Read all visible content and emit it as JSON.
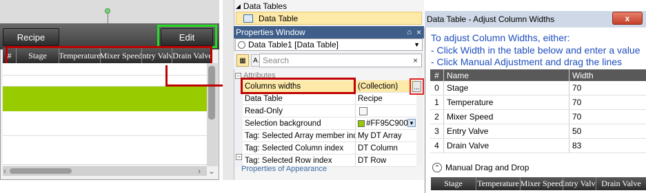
{
  "left_panel": {
    "recipe_button": "Recipe",
    "edit_button": "Edit",
    "table_headers": [
      "#",
      "Stage",
      "Temperature",
      "Mixer Speed",
      "Entry Valve",
      "Drain Valve"
    ],
    "highlight_row_color": "#99CC00"
  },
  "tree": {
    "data_tables_label": "Data Tables",
    "data_table_label": "Data Table"
  },
  "properties": {
    "title": "Properties Window",
    "pin_glyph": "⌂",
    "close_glyph": "×",
    "object_label": "Data Table1 [Data Table]",
    "search_placeholder": "Search",
    "attributes_label": "Attributes",
    "rows": [
      {
        "name": "Columns widths",
        "value": "(Collection)"
      },
      {
        "name": "Data Table",
        "value": "Recipe"
      },
      {
        "name": "Read-Only",
        "value": ""
      },
      {
        "name": "Selection background",
        "value": "#FF95C900"
      },
      {
        "name": "Tag: Selected Array member index",
        "value": "My DT Array"
      },
      {
        "name": "Tag: Selected Column index",
        "value": "DT Column"
      },
      {
        "name": "Tag: Selected Row index",
        "value": "DT Row"
      }
    ],
    "swatch_color": "#95C900",
    "ellipsis": "...",
    "bottom_link": "Properties of Appearance"
  },
  "dialog": {
    "title": "Data Table - Adjust Column Widths",
    "close_glyph": "x",
    "instructions": [
      "To adjust Column Widths, either:",
      "- Click Width in the table below and enter a value",
      "- Click Manual Adjustment and drag the lines"
    ],
    "table_head": {
      "idx": "#",
      "name": "Name",
      "width": "Width"
    },
    "rows": [
      {
        "idx": "0",
        "name": "Stage",
        "width": "70"
      },
      {
        "idx": "1",
        "name": "Temperature",
        "width": "70"
      },
      {
        "idx": "2",
        "name": "Mixer Speed",
        "width": "70"
      },
      {
        "idx": "3",
        "name": "Entry Valve",
        "width": "50"
      },
      {
        "idx": "4",
        "name": "Drain Valve",
        "width": "83"
      }
    ],
    "manual_label": "Manual Drag and Drop",
    "preview_headers": [
      "Stage",
      "Temperature",
      "Mixer Speed",
      "Entry Valve",
      "Drain Valve"
    ]
  },
  "colors": {
    "highlight_green": "#22DD22",
    "highlight_red": "#C00000",
    "instruction_blue": "#1F4FBF"
  }
}
